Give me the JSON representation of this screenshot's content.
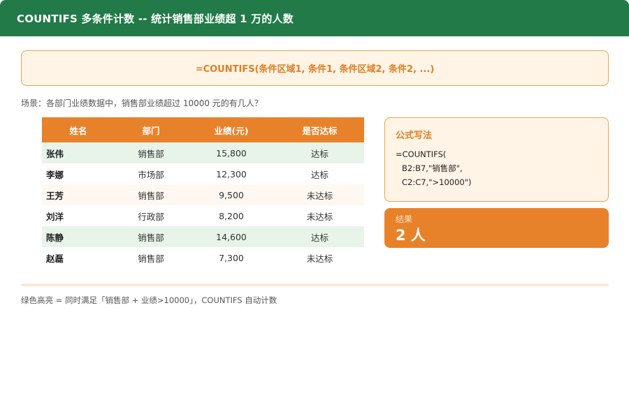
{
  "header": {
    "title": "COUNTIFS 多条件计数 -- 统计销售部业绩超 1 万的人数"
  },
  "syntax": "=COUNTIFS(条件区域1, 条件1, 条件区域2, 条件2, ...)",
  "scenario": "场景：各部门业绩数据中，销售部业绩超过 10000 元的有几人？",
  "table": {
    "headers": [
      "姓名",
      "部门",
      "业绩(元)",
      "是否达标"
    ],
    "rows": [
      {
        "name": "张伟",
        "dept": "销售部",
        "sales": "15,800",
        "status": "达标",
        "highlight": "green"
      },
      {
        "name": "李娜",
        "dept": "市场部",
        "sales": "12,300",
        "status": "达标",
        "highlight": "none"
      },
      {
        "name": "王芳",
        "dept": "销售部",
        "sales": "9,500",
        "status": "未达标",
        "highlight": "orange"
      },
      {
        "name": "刘洋",
        "dept": "行政部",
        "sales": "8,200",
        "status": "未达标",
        "highlight": "none"
      },
      {
        "name": "陈静",
        "dept": "销售部",
        "sales": "14,600",
        "status": "达标",
        "highlight": "green"
      },
      {
        "name": "赵磊",
        "dept": "销售部",
        "sales": "7,300",
        "status": "未达标",
        "highlight": "none"
      }
    ]
  },
  "formula_card": {
    "title": "公式写法",
    "lines": [
      "=COUNTIFS(",
      "B2:B7,\"销售部\",",
      "C2:C7,\">10000\")"
    ]
  },
  "result": {
    "label": "结果",
    "value": "2 人"
  },
  "footnote": "绿色高亮 = 同时满足「销售部 + 业绩>10000」，COUNTIFS 自动计数",
  "colors": {
    "header_bg": "#217a47",
    "accent_orange": "#e8822a",
    "highlight_green": "#e8f4ea",
    "status_ok": "#217a47",
    "status_no": "#d2462e"
  }
}
